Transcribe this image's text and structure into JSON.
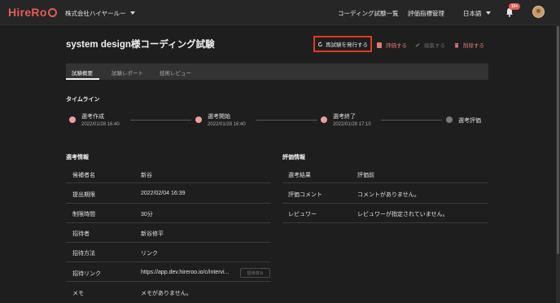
{
  "nav": {
    "logo": "HireRo",
    "company": "株式会社ハイヤールー",
    "links": [
      "コーディング試験一覧",
      "評価指標管理"
    ],
    "language": "日本語",
    "notification_badge": "10+"
  },
  "header": {
    "title": "system design様コーディング試験",
    "reissue_label": "再試験を発行する",
    "evaluate_label": "評価する",
    "edit_label": "編集する",
    "delete_label": "削除する"
  },
  "tabs": [
    {
      "label": "試験概要",
      "active": true
    },
    {
      "label": "試験レポート",
      "active": false
    },
    {
      "label": "技術レビュー",
      "active": false
    }
  ],
  "timeline": {
    "title": "タイムライン",
    "steps": [
      {
        "label": "選考作成",
        "date": "2022/01/28 16:40",
        "status": "done"
      },
      {
        "label": "選考開始",
        "date": "2022/01/28 16:40",
        "status": "done"
      },
      {
        "label": "選考終了",
        "date": "2022/01/28 17:10",
        "status": "done"
      },
      {
        "label": "選考評価",
        "date": "",
        "status": "pending"
      }
    ]
  },
  "selection_info": {
    "title": "選考情報",
    "rows": [
      {
        "label": "候補者名",
        "value": "新谷"
      },
      {
        "label": "提出期限",
        "value": "2022/02/04 16:39"
      },
      {
        "label": "制限時間",
        "value": "30分"
      },
      {
        "label": "招待者",
        "value": "新谷修平"
      },
      {
        "label": "招待方法",
        "value": "リンク"
      },
      {
        "label": "招待リンク",
        "value": "https://app.dev.hireroo.io/c/intervi..."
      },
      {
        "label": "メモ",
        "value": "メモがありません。"
      }
    ],
    "copied_label": "招待済み"
  },
  "evaluation_info": {
    "title": "評価情報",
    "rows": [
      {
        "label": "選考結果",
        "value": "評価前"
      },
      {
        "label": "評価コメント",
        "value": "コメントがありません。"
      },
      {
        "label": "レビュワー",
        "value": "レビュワーが指定されていません。"
      }
    ]
  },
  "colors": {
    "accent": "#e45b58",
    "highlight_border": "#e4391b",
    "background": "#1e1e1e"
  }
}
